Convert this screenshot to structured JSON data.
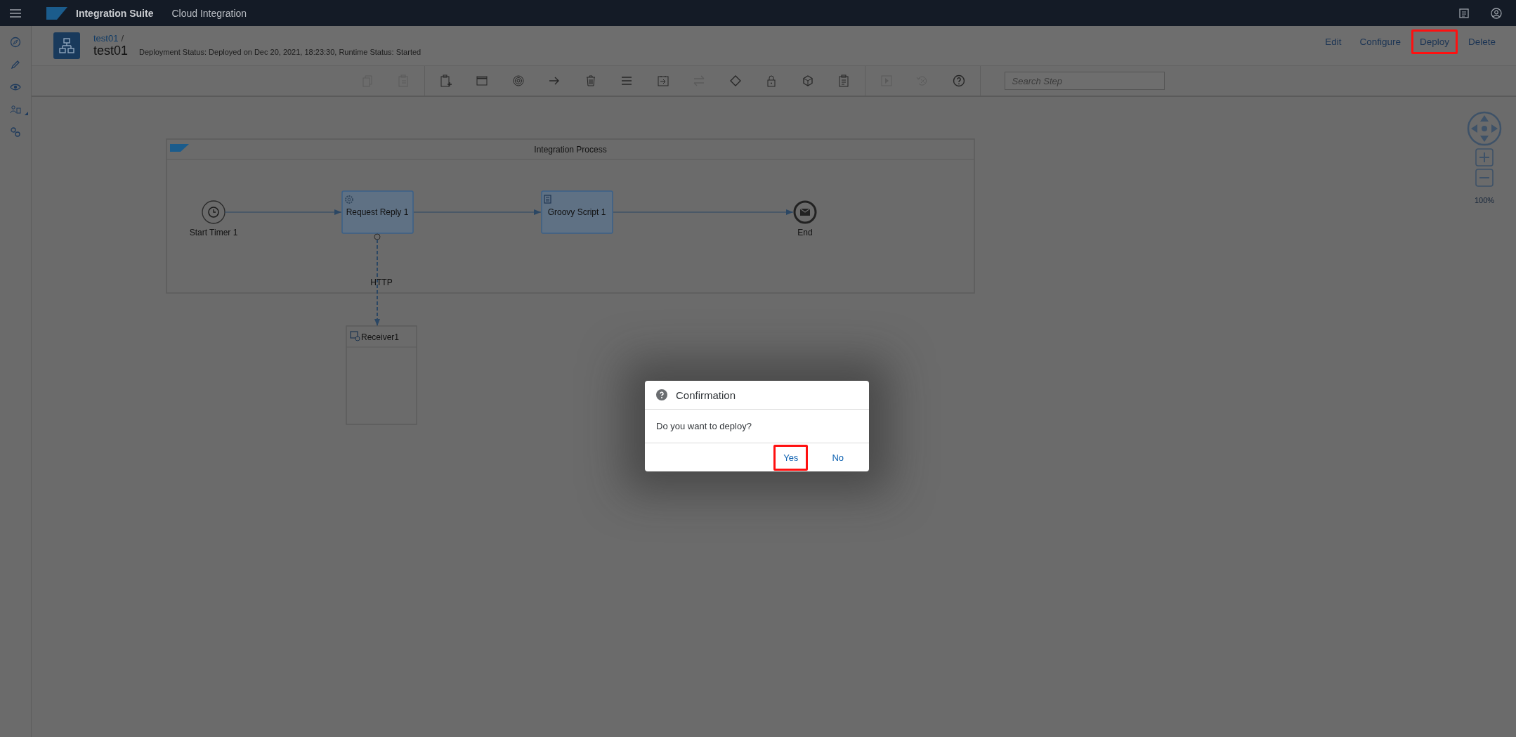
{
  "shell_bar": {
    "product": "Integration Suite",
    "app": "Cloud Integration"
  },
  "header": {
    "breadcrumb": "test01",
    "separator": "/",
    "title": "test01",
    "status": "Deployment Status: Deployed on Dec 20, 2021, 18:23:30, Runtime Status: Started",
    "actions": [
      {
        "label": "Edit",
        "highlighted": false
      },
      {
        "label": "Configure",
        "highlighted": false
      },
      {
        "label": "Deploy",
        "highlighted": true
      },
      {
        "label": "Delete",
        "highlighted": false
      }
    ]
  },
  "toolbar": {
    "tools": [
      {
        "kind": "copy",
        "disabled": true
      },
      {
        "kind": "paste",
        "disabled": true
      },
      {
        "kind": "separator"
      },
      {
        "kind": "add-task",
        "disabled": false
      },
      {
        "kind": "window",
        "disabled": false
      },
      {
        "kind": "target",
        "disabled": false
      },
      {
        "kind": "arrow",
        "disabled": false
      },
      {
        "kind": "trash",
        "disabled": false
      },
      {
        "kind": "menu",
        "disabled": false
      },
      {
        "kind": "import",
        "disabled": false
      },
      {
        "kind": "swap",
        "disabled": true
      },
      {
        "kind": "diamond",
        "disabled": false
      },
      {
        "kind": "lock",
        "disabled": false
      },
      {
        "kind": "cube",
        "disabled": false
      },
      {
        "kind": "clipboard",
        "disabled": false
      },
      {
        "kind": "separator"
      },
      {
        "kind": "play",
        "disabled": true
      },
      {
        "kind": "cancel",
        "disabled": true
      },
      {
        "kind": "help",
        "disabled": false
      },
      {
        "kind": "separator"
      }
    ],
    "search": {
      "placeholder": "Search Step"
    }
  },
  "diagram": {
    "pool_title": "Integration Process",
    "nodes": [
      {
        "kind": "timer",
        "label": "Start Timer 1"
      },
      {
        "kind": "request-reply",
        "label": "Request Reply 1"
      },
      {
        "kind": "script",
        "label": "Groovy Script 1"
      },
      {
        "kind": "end",
        "label": "End"
      }
    ],
    "connection_label": "HTTP",
    "receiver": {
      "label": "Receiver1"
    }
  },
  "zoom": {
    "reading": "100%"
  },
  "dialog": {
    "title": "Confirmation",
    "message": "Do you want to deploy?",
    "buttons": [
      {
        "label": "Yes",
        "highlighted": true
      },
      {
        "label": "No",
        "highlighted": false
      }
    ]
  }
}
